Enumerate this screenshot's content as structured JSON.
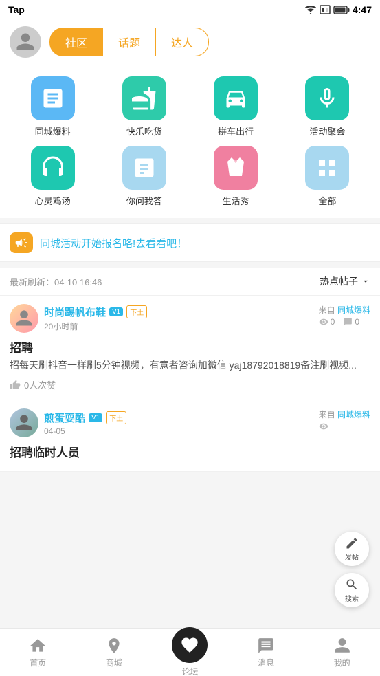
{
  "statusBar": {
    "appName": "Tap",
    "time": "4:47"
  },
  "header": {
    "tabs": [
      {
        "id": "community",
        "label": "社区",
        "active": true
      },
      {
        "id": "topic",
        "label": "话题",
        "active": false
      },
      {
        "id": "expert",
        "label": "达人",
        "active": false
      }
    ]
  },
  "categories": [
    {
      "id": "local-news",
      "label": "同城爆料",
      "icon": "newspaper",
      "color": "blue"
    },
    {
      "id": "food",
      "label": "快乐吃货",
      "icon": "food",
      "color": "green"
    },
    {
      "id": "carpool",
      "label": "拼车出行",
      "icon": "car",
      "color": "teal"
    },
    {
      "id": "events",
      "label": "活动聚会",
      "icon": "mic",
      "color": "teal"
    },
    {
      "id": "soul-soup",
      "label": "心灵鸡汤",
      "icon": "headphones",
      "color": "teal"
    },
    {
      "id": "qa",
      "label": "你问我答",
      "icon": "qa",
      "color": "lightblue"
    },
    {
      "id": "life-show",
      "label": "生活秀",
      "icon": "dress",
      "color": "pink"
    },
    {
      "id": "all",
      "label": "全部",
      "icon": "grid",
      "color": "lightblue"
    }
  ],
  "announcement": {
    "text": "同城活动开始报名咯!去看看吧！"
  },
  "feedHeader": {
    "timestamp": "最新刷新：04-10 16:46",
    "filter": "热点帖子"
  },
  "posts": [
    {
      "id": "post1",
      "username": "时尚踢帆布鞋",
      "badges": [
        "V1",
        "下土"
      ],
      "time": "20小时前",
      "source": "来自 同城爆料",
      "views": "0",
      "comments": "0",
      "title": "招聘",
      "body": "招每天刷抖音一样刷5分钟视频，有意者咨询加微信 yaj18792018819备注刷视频...",
      "likes": "0人次赞"
    },
    {
      "id": "post2",
      "username": "煎蛋耍酷",
      "badges": [
        "V1",
        "下土"
      ],
      "time": "04-05",
      "source": "来自 同城爆料",
      "views": "",
      "comments": "",
      "title": "招聘临时人员",
      "body": "",
      "likes": ""
    }
  ],
  "fab": {
    "post": "发帖",
    "search": "搜索"
  },
  "bottomNav": [
    {
      "id": "home",
      "label": "首页",
      "active": false
    },
    {
      "id": "shop",
      "label": "商城",
      "active": false
    },
    {
      "id": "forum",
      "label": "论坛",
      "active": true,
      "center": true
    },
    {
      "id": "messages",
      "label": "消息",
      "active": false
    },
    {
      "id": "profile",
      "label": "我的",
      "active": false
    }
  ]
}
